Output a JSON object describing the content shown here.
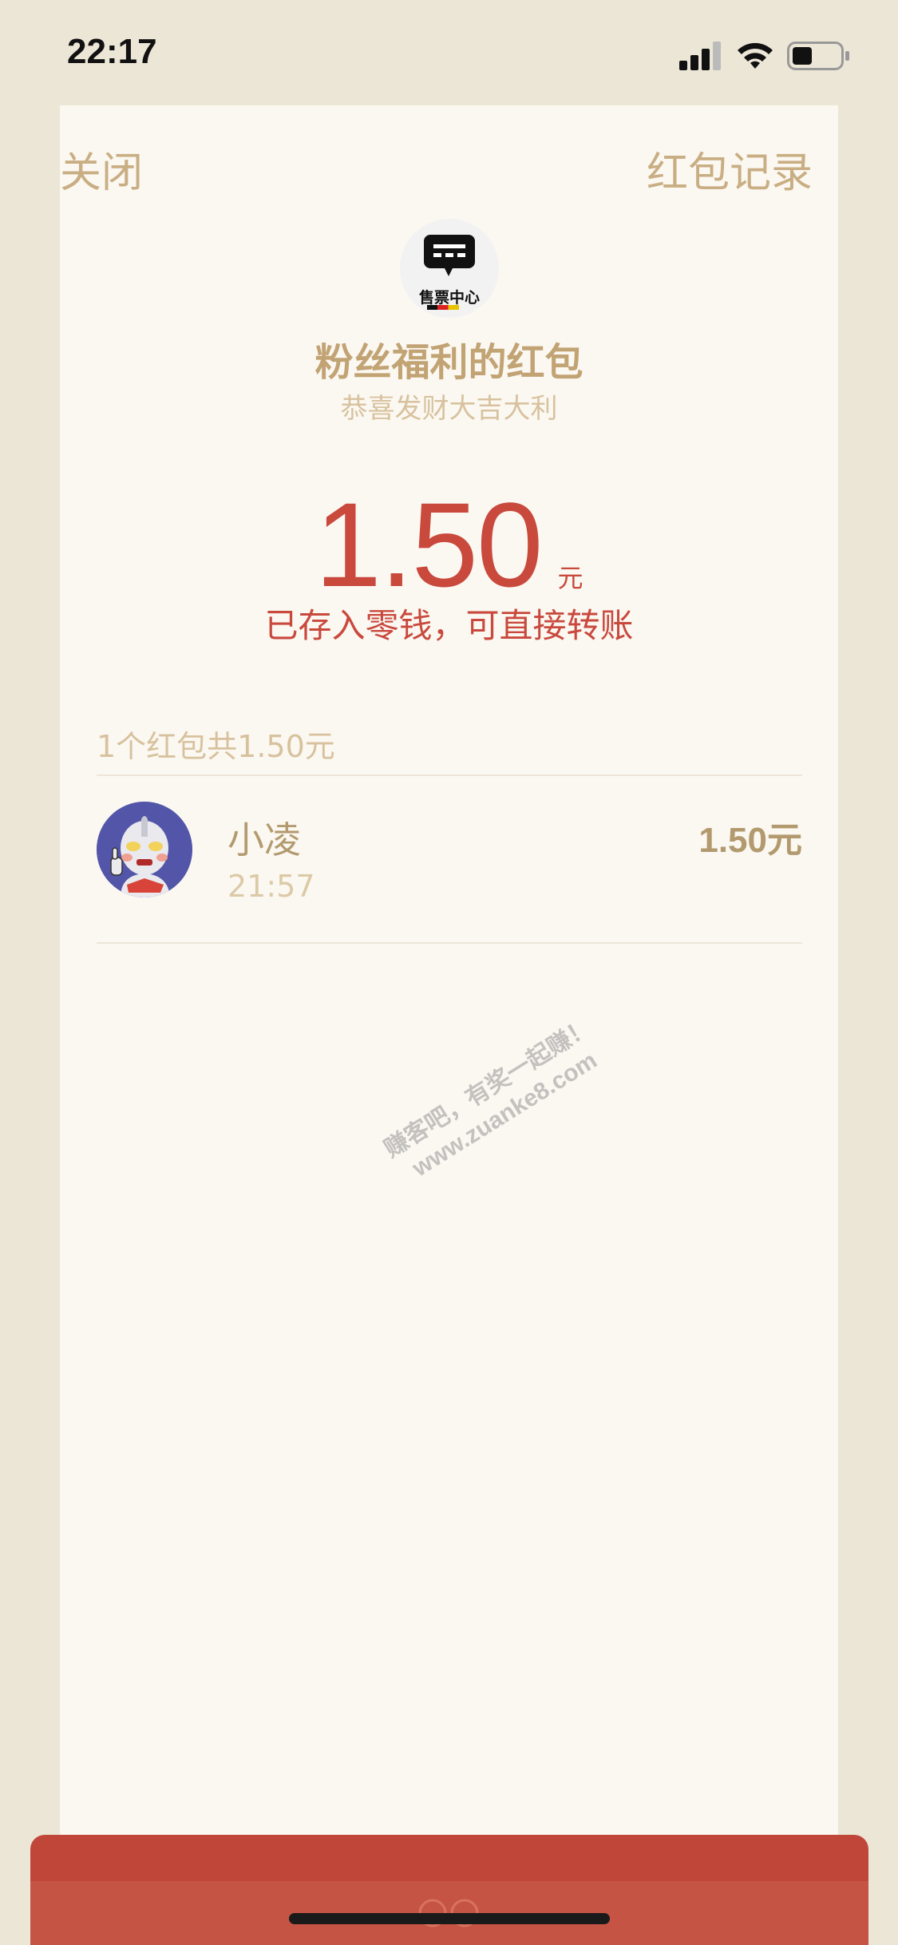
{
  "status_bar": {
    "time": "22:17"
  },
  "nav": {
    "close_label": "关闭",
    "records_label": "红包记录"
  },
  "sender": {
    "avatar_text": "售票中心",
    "title": "粉丝福利的红包",
    "greeting": "恭喜发财大吉大利"
  },
  "amount": {
    "value": "1.50",
    "unit": "元",
    "note": "已存入零钱，可直接转账"
  },
  "summary": "1个红包共1.50元",
  "records": [
    {
      "name": "小凌",
      "time": "21:57",
      "amount": "1.50元",
      "avatar_icon": "ultraman-avatar-icon"
    }
  ],
  "watermark": {
    "line1": "赚客吧，有奖一起赚！",
    "line2": "www.zuanke8.com"
  },
  "colors": {
    "page_background": "#ECE6D6",
    "card_background": "#FBF8F2",
    "accent_gold": "#C9AE83",
    "amount_red": "#C9493D",
    "envelope_red": "#C0463A"
  }
}
